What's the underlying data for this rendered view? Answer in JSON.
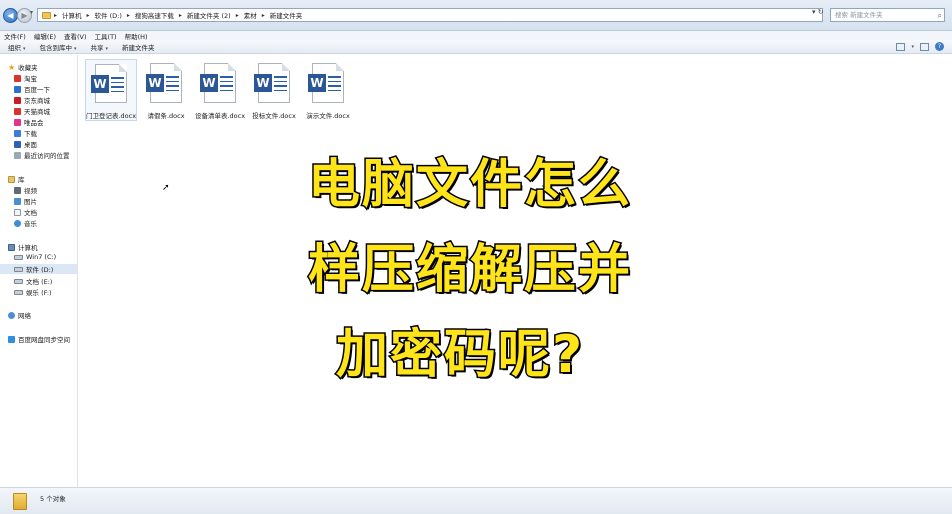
{
  "address_bar": {
    "crumbs": [
      "计算机",
      "软件 (D:)",
      "搜狗高速下载",
      "新建文件夹 (2)",
      "素材",
      "新建文件夹"
    ],
    "search_placeholder": "搜索 新建文件夹"
  },
  "menu": [
    "文件(F)",
    "编辑(E)",
    "查看(V)",
    "工具(T)",
    "帮助(H)"
  ],
  "toolbar": {
    "items": [
      "组织",
      "包含到库中",
      "共享",
      "新建文件夹"
    ]
  },
  "sidebar": {
    "favorites_label": "收藏夹",
    "favorites": [
      "淘宝",
      "百度一下",
      "京东商城",
      "天猫商城",
      "唯品会",
      "下载",
      "桌面",
      "最近访问的位置"
    ],
    "library_label": "库",
    "libraries": [
      "视频",
      "图片",
      "文档",
      "音乐"
    ],
    "computer_label": "计算机",
    "drives": [
      "Win7 (C:)",
      "软件 (D:)",
      "文档 (E:)",
      "娱乐 (F:)"
    ],
    "network_label": "网络",
    "cloud_label": "百度网盘同步空间"
  },
  "files": [
    "门卫登记表.docx",
    "请假条.docx",
    "设备清单表.docx",
    "投标文件.docx",
    "演示文件.docx"
  ],
  "overlay": {
    "line1": "电脑文件怎么",
    "line2": "样压缩解压并",
    "line3": "加密码呢?"
  },
  "status": {
    "count": "5 个对象"
  },
  "colors": {
    "overlay_text": "#ffe41a",
    "word_blue": "#2b5797",
    "selection": "#dbe7f4"
  }
}
